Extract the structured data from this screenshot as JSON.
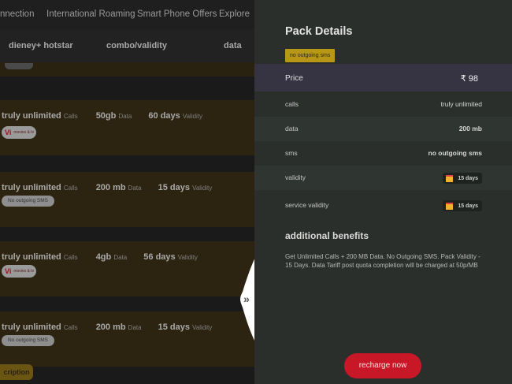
{
  "nav": [
    "nnection",
    "International Roaming",
    "Smart Phone Offers",
    "Explore"
  ],
  "filters": [
    "dieney+ hotstar",
    "combo/validity",
    "data"
  ],
  "plans": [
    {
      "calls": "truly unlimited",
      "calls_suffix": "Calls",
      "data": "50gb",
      "data_suffix": "Data",
      "validity": "60 days",
      "validity_suffix": "Validity",
      "badge": "ott",
      "badge_vi": "Vi",
      "badge_text": "movies & tv"
    },
    {
      "calls": "truly unlimited",
      "calls_suffix": "Calls",
      "data": "200 mb",
      "data_suffix": "Data",
      "validity": "15 days",
      "validity_suffix": "Validity",
      "badge": "sms",
      "badge_text": "No outgoing SMS"
    },
    {
      "calls": "truly unlimited",
      "calls_suffix": "Calls",
      "data": "4gb",
      "data_suffix": "Data",
      "validity": "56 days",
      "validity_suffix": "Validity",
      "badge": "ott",
      "badge_vi": "Vi",
      "badge_text": "movies & tv"
    },
    {
      "calls": "truly unlimited",
      "calls_suffix": "Calls",
      "data": "200 mb",
      "data_suffix": "Data",
      "validity": "15 days",
      "validity_suffix": "Validity",
      "badge": "sms",
      "badge_text": "No outgoing SMS"
    }
  ],
  "subscription_label": "cription",
  "handle_arrow": "»",
  "panel": {
    "title": "Pack Details",
    "tag": "no outgoing sms",
    "price_label": "Price",
    "price_value": "₹ 98",
    "rows": [
      {
        "label": "calls",
        "value": "truly unlimited"
      },
      {
        "label": "data",
        "value": "200 mb"
      },
      {
        "label": "sms",
        "value": "no outgoing sms"
      },
      {
        "label": "validity",
        "value": "15 days"
      },
      {
        "label": "service validity",
        "value": "15 days"
      }
    ],
    "additional_title": "additional benefits",
    "additional_text": "Get Unlimited Calls + 200 MB Data. No Outgoing SMS. Pack Validity - 15 Days. Data Tariff post quota completion will be charged at 50p/MB",
    "button": "recharge now"
  },
  "colors": {
    "accent_red": "#c81827",
    "tag_gold": "#b89616",
    "card_brown": "#2c2410"
  }
}
